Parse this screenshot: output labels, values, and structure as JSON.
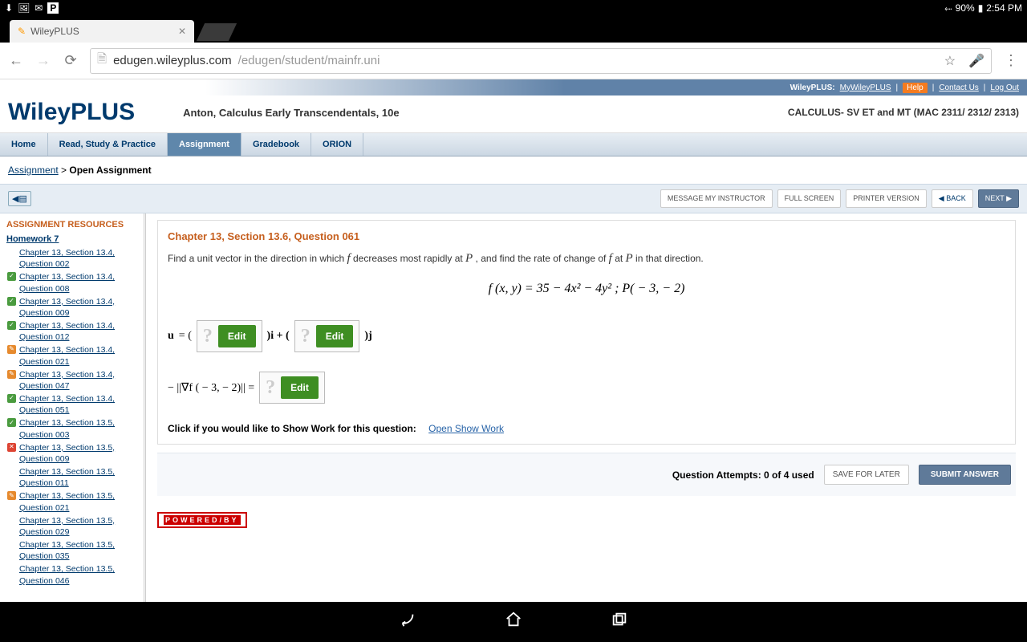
{
  "status": {
    "battery": "90%",
    "time": "2:54 PM"
  },
  "tab": {
    "title": "WileyPLUS"
  },
  "url": {
    "host": "edugen.wileyplus.com",
    "path": "/edugen/student/mainfr.uni"
  },
  "topLinks": {
    "brand": "WileyPLUS:",
    "my": "MyWileyPLUS",
    "help": "Help",
    "contact": "Contact Us",
    "logout": "Log Out"
  },
  "logo": {
    "a": "Wiley",
    "b": "PLUS"
  },
  "book": "Anton, Calculus Early Transcendentals, 10e",
  "course": "CALCULUS- SV ET and MT (MAC 2311/ 2312/ 2313)",
  "tabs": [
    "Home",
    "Read, Study & Practice",
    "Assignment",
    "Gradebook",
    "ORION"
  ],
  "activeTab": 2,
  "breadcrumb": {
    "link": "Assignment",
    "current": "Open Assignment"
  },
  "toolbar": {
    "msg": "MESSAGE MY INSTRUCTOR",
    "full": "FULL SCREEN",
    "print": "PRINTER VERSION",
    "back": "BACK",
    "next": "NEXT"
  },
  "sidebar": {
    "title": "ASSIGNMENT RESOURCES",
    "hw": "Homework 7",
    "items": [
      {
        "t": "Chapter 13, Section 13.4, Question 002",
        "s": ""
      },
      {
        "t": "Chapter 13, Section 13.4, Question 008",
        "s": "green"
      },
      {
        "t": "Chapter 13, Section 13.4, Question 009",
        "s": "green"
      },
      {
        "t": "Chapter 13, Section 13.4, Question 012",
        "s": "green"
      },
      {
        "t": "Chapter 13, Section 13.4, Question 021",
        "s": "orange"
      },
      {
        "t": "Chapter 13, Section 13.4, Question 047",
        "s": "orange"
      },
      {
        "t": "Chapter 13, Section 13.4, Question 051",
        "s": "green"
      },
      {
        "t": "Chapter 13, Section 13.5, Question 003",
        "s": "green"
      },
      {
        "t": "Chapter 13, Section 13.5, Question 009",
        "s": "red"
      },
      {
        "t": "Chapter 13, Section 13.5, Question 011",
        "s": ""
      },
      {
        "t": "Chapter 13, Section 13.5, Question 021",
        "s": "orange"
      },
      {
        "t": "Chapter 13, Section 13.5, Question 029",
        "s": ""
      },
      {
        "t": "Chapter 13, Section 13.5, Question 035",
        "s": ""
      },
      {
        "t": "Chapter 13, Section 13.5, Question 046",
        "s": ""
      }
    ]
  },
  "question": {
    "header": "Chapter 13, Section 13.6, Question 061",
    "prompt1": "Find a unit vector in the direction in which ",
    "prompt2": " decreases most rapidly at ",
    "prompt3": " , and find the rate of change of ",
    "prompt4": " at ",
    "prompt5": " in that direction.",
    "formula": "f (x, y) = 35 − 4x² − 4y² ;  P( − 3,  − 2)",
    "u": "u",
    "eq": " = ( ",
    "iplus": " )i + ( ",
    "jend": " )j",
    "grad": "− ||∇f ( − 3,  − 2)|| = ",
    "edit": "Edit",
    "showWorkLabel": "Click if you would like to Show Work for this question:",
    "showWorkLink": "Open Show Work"
  },
  "attempts": {
    "text": "Question Attempts: 0 of 4 used",
    "save": "SAVE FOR LATER",
    "submit": "SUBMIT ANSWER"
  },
  "powered": "POWERED/BY"
}
